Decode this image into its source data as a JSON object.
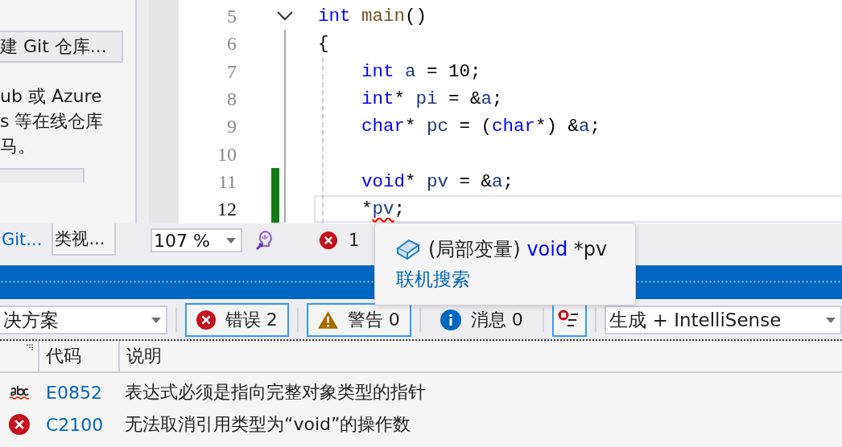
{
  "left_panel": {
    "create_button": "建 Git 仓库...",
    "description_lines": [
      "ub 或 Azure",
      "s 等在线仓库",
      "马。"
    ],
    "tabs": [
      {
        "label": "Git...",
        "selected": false
      },
      {
        "label": "类视...",
        "selected": true
      }
    ]
  },
  "editor": {
    "lines": [
      {
        "number": "5",
        "current": false,
        "changed": false,
        "foldable": true,
        "indented": false,
        "tokens": [
          {
            "kind": "keyword",
            "text": "int"
          },
          {
            "kind": "function",
            "text": " main"
          },
          {
            "kind": "plain",
            "text": "()"
          }
        ]
      },
      {
        "number": "6",
        "current": false,
        "changed": false,
        "foldable": false,
        "indented": false,
        "tokens": [
          {
            "kind": "plain",
            "text": "{"
          }
        ]
      },
      {
        "number": "7",
        "current": false,
        "changed": false,
        "foldable": false,
        "indented": true,
        "tokens": [
          {
            "kind": "keyword",
            "text": "int"
          },
          {
            "kind": "variable",
            "text": " a"
          },
          {
            "kind": "plain",
            "text": " = 10;"
          }
        ]
      },
      {
        "number": "8",
        "current": false,
        "changed": false,
        "foldable": false,
        "indented": true,
        "tokens": [
          {
            "kind": "keyword",
            "text": "int"
          },
          {
            "kind": "plain",
            "text": "* "
          },
          {
            "kind": "variable",
            "text": "pi"
          },
          {
            "kind": "plain",
            "text": " = &"
          },
          {
            "kind": "variable",
            "text": "a"
          },
          {
            "kind": "plain",
            "text": ";"
          }
        ]
      },
      {
        "number": "9",
        "current": false,
        "changed": false,
        "foldable": false,
        "indented": true,
        "tokens": [
          {
            "kind": "keyword",
            "text": "char"
          },
          {
            "kind": "plain",
            "text": "* "
          },
          {
            "kind": "variable",
            "text": "pc"
          },
          {
            "kind": "plain",
            "text": " = ("
          },
          {
            "kind": "keyword",
            "text": "char"
          },
          {
            "kind": "plain",
            "text": "*) &"
          },
          {
            "kind": "variable",
            "text": "a"
          },
          {
            "kind": "plain",
            "text": ";"
          }
        ]
      },
      {
        "number": "10",
        "current": false,
        "changed": false,
        "foldable": false
      },
      {
        "number": "11",
        "current": false,
        "changed": true,
        "foldable": false,
        "indented": true,
        "tokens": [
          {
            "kind": "keyword",
            "text": "void"
          },
          {
            "kind": "plain",
            "text": "* "
          },
          {
            "kind": "variable",
            "text": "pv"
          },
          {
            "kind": "plain",
            "text": " = &"
          },
          {
            "kind": "variable",
            "text": "a"
          },
          {
            "kind": "plain",
            "text": ";"
          }
        ]
      },
      {
        "number": "12",
        "current": true,
        "changed": true,
        "foldable": false,
        "indented": true,
        "tokens": [
          {
            "kind": "plain",
            "text": "*"
          },
          {
            "kind": "error",
            "text": "pv"
          },
          {
            "kind": "plain",
            "text": ";"
          }
        ]
      }
    ],
    "zoom": "107 %",
    "error_count": "1"
  },
  "tooltip": {
    "prefix": "(局部变量)",
    "type": "void",
    "name": "*pv",
    "link": "联机搜索"
  },
  "error_list": {
    "scope_dropdown": "决方案",
    "filters": [
      {
        "kind": "error",
        "label": "错误 2",
        "selected": true
      },
      {
        "kind": "warning",
        "label": "警告 0",
        "selected": true
      },
      {
        "kind": "message",
        "label": "消息 0",
        "selected": false
      }
    ],
    "filter_toggle_selected": true,
    "source_dropdown": "生成 + IntelliSense",
    "columns": [
      "代码",
      "说明"
    ],
    "rows": [
      {
        "kind": "intellisense",
        "code": "E0852",
        "description": "表达式必须是指向完整对象类型的指针"
      },
      {
        "kind": "error",
        "code": "C2100",
        "description": "无法取消引用类型为“void”的操作数"
      }
    ]
  }
}
